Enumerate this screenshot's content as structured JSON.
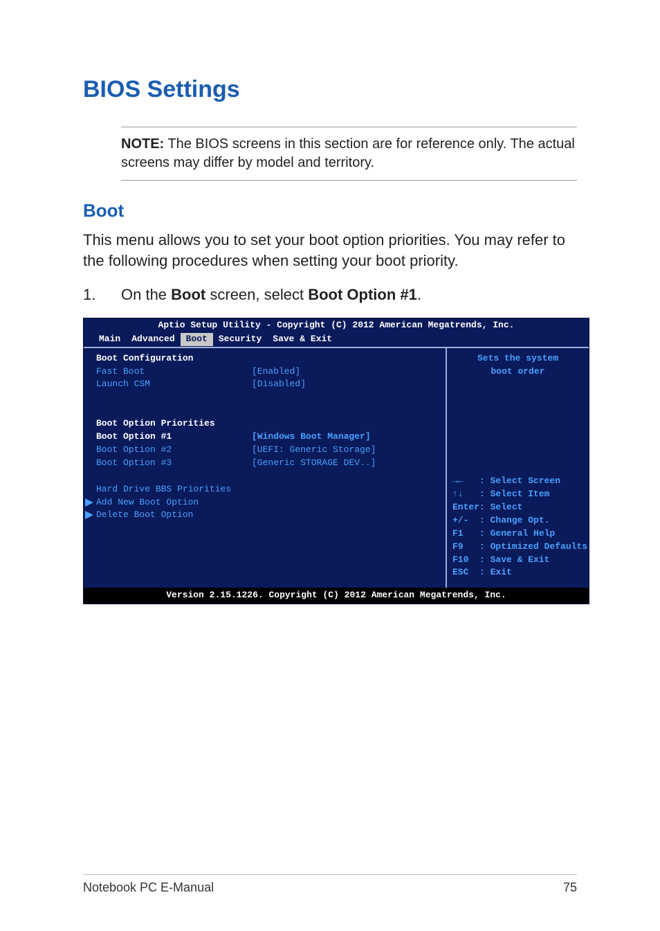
{
  "heading": "BIOS Settings",
  "note_label": "NOTE:",
  "note_text": " The BIOS screens in this section are for reference only. The actual screens may differ by model and territory.",
  "subheading": "Boot",
  "intro": "This menu allows you to set your boot option priorities. You may refer to the following procedures when setting your boot priority.",
  "step_num": "1.",
  "step_pre": "On the ",
  "step_bold1": "Boot",
  "step_mid": " screen, select ",
  "step_bold2": "Boot Option #1",
  "step_post": ".",
  "bios": {
    "title": "Aptio Setup Utility - Copyright (C) 2012 American Megatrends, Inc.",
    "tabs": [
      "Main",
      "Advanced",
      "Boot",
      "Security",
      "Save & Exit"
    ],
    "active_tab": "Boot",
    "section1": "Boot Configuration",
    "rows": [
      {
        "label": "Fast Boot",
        "value": "[Enabled]",
        "sel": false
      },
      {
        "label": "Launch CSM",
        "value": "[Disabled]",
        "sel": false
      }
    ],
    "section2": "Boot Option Priorities",
    "priorities": [
      {
        "label": "Boot Option #1",
        "value": "[Windows Boot Manager]",
        "sel": true
      },
      {
        "label": "Boot Option #2",
        "value": "[UEFI: Generic Storage]",
        "sel": false
      },
      {
        "label": "Boot Option #3",
        "value": "[Generic STORAGE DEV..]",
        "sel": false
      }
    ],
    "extra": [
      "Hard Drive BBS Priorities",
      "Add New Boot Option",
      "Delete Boot Option"
    ],
    "help_title": "Sets the system",
    "help_text": "boot order",
    "keys": [
      "→←   : Select Screen",
      "↑↓   : Select Item",
      "Enter: Select",
      "+/-  : Change Opt.",
      "F1   : General Help",
      "F9   : Optimized Defaults",
      "F10  : Save & Exit",
      "ESC  : Exit"
    ],
    "footer": "Version 2.15.1226. Copyright (C) 2012 American Megatrends, Inc."
  },
  "footer_left": "Notebook PC E-Manual",
  "footer_right": "75"
}
